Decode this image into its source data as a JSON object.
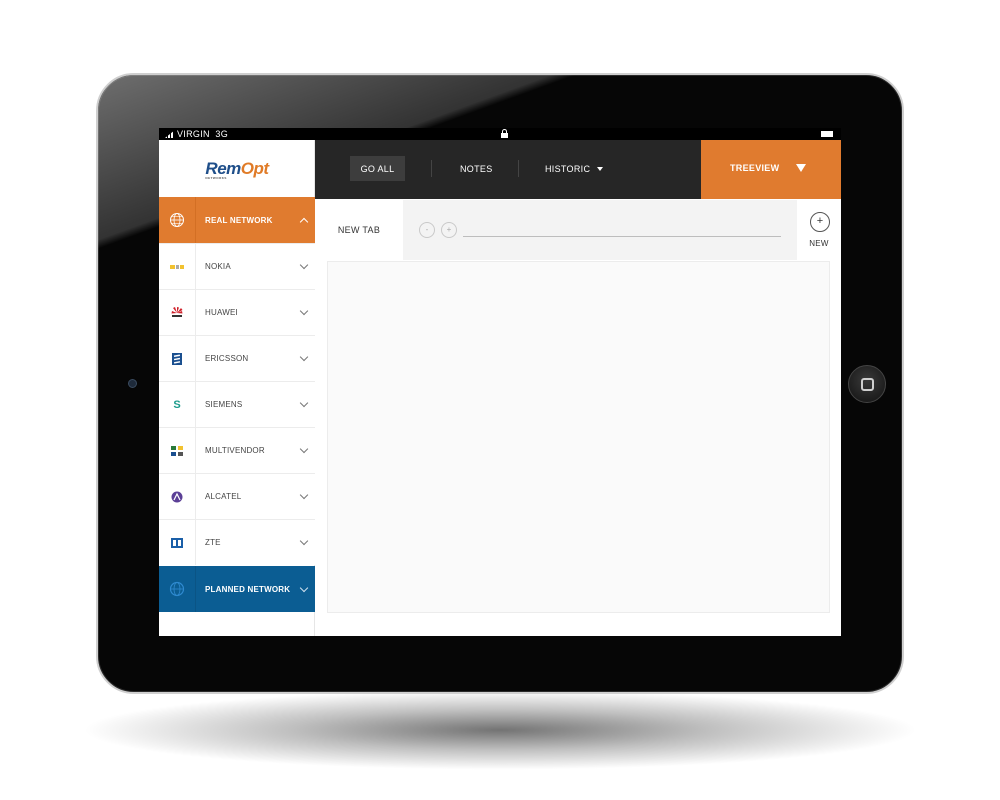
{
  "status_bar": {
    "carrier": "VIRGIN",
    "network": "3G"
  },
  "logo": {
    "main": "Rem",
    "accent": "Opt",
    "sub": "NETWORKS"
  },
  "sidebar": {
    "items": [
      {
        "label": "REAL NETWORK",
        "icon": "globe-icon",
        "state": "active"
      },
      {
        "label": "NOKIA",
        "icon": "nokia-logo-icon"
      },
      {
        "label": "HUAWEI",
        "icon": "huawei-logo-icon"
      },
      {
        "label": "ERICSSON",
        "icon": "ericsson-logo-icon"
      },
      {
        "label": "SIEMENS",
        "icon": "siemens-logo-icon",
        "glyph": "S"
      },
      {
        "label": "MULTIVENDOR",
        "icon": "multivendor-icon"
      },
      {
        "label": "ALCATEL",
        "icon": "alcatel-logo-icon"
      },
      {
        "label": "ZTE",
        "icon": "zte-logo-icon"
      },
      {
        "label": "PLANNED NETWORK",
        "icon": "planned-network-icon",
        "state": "highlight"
      }
    ]
  },
  "topbar": {
    "go_all": "GO ALL",
    "notes": "NOTES",
    "historic": "HISTORIC",
    "treeview": "TREEVIEW"
  },
  "tabs": {
    "active_tab": "NEW TAB",
    "zoom_out": "-",
    "zoom_in": "+",
    "new_button": "+",
    "new_label": "NEW"
  },
  "colors": {
    "accent_orange": "#e07b2f",
    "planned_blue": "#0b5d93",
    "topbar_dark": "#262626"
  }
}
